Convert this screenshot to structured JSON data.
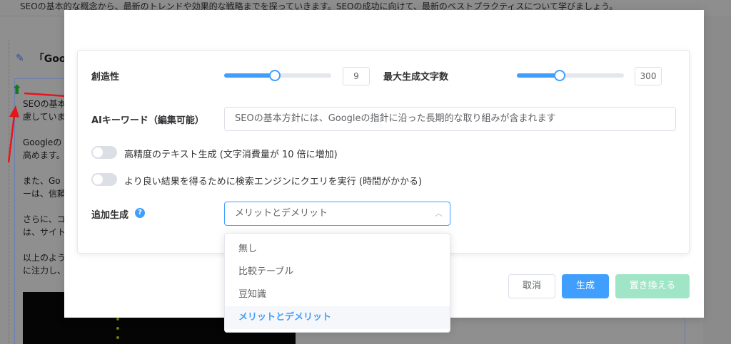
{
  "background": {
    "top_text": "SEOの基本的な概念から、最新のトレンドや効果的な戦略までを探っていきます。SEOの成功に向けて、最新のベストプラクティスについて学びましょう。",
    "heading": "「Goo",
    "paragraphs": [
      "SEOの基本",
      "慮していま",
      "Googleの",
      "高めます。",
      "また、Go",
      "ーは、信頼",
      "さらに、コ",
      "は、サイト",
      "以上のよう",
      "に注力し、"
    ]
  },
  "dialog": {
    "creativity_label": "創造性",
    "creativity_value": "9",
    "creativity_fraction": 0.47,
    "max_chars_label": "最大生成文字数",
    "max_chars_value": "300",
    "max_chars_fraction": 0.4,
    "keyword_label": "AIキーワード（編集可能）",
    "keyword_value": "SEOの基本方針には、Googleの指針に沿った長期的な取り組みが含まれます",
    "toggle_high_precision": "高精度のテキスト生成 (文字消費量が 10 倍に増加)",
    "toggle_search": "より良い結果を得るために検索エンジンにクエリを実行 (時間がかかる)",
    "additional_label": "追加生成",
    "additional_selected": "メリットとデメリット",
    "options": [
      "無し",
      "比較テーブル",
      "豆知識",
      "メリットとデメリット"
    ],
    "cancel": "取消",
    "generate": "生成",
    "replace": "置き換える"
  },
  "icons": {
    "help": "?",
    "chevron": "︿",
    "pencil": "✎",
    "up_arrow": "⬆"
  },
  "colors": {
    "accent": "#409eff",
    "replace_disabled": "#a0e6c6",
    "annotation_arrow": "#e8141b"
  }
}
